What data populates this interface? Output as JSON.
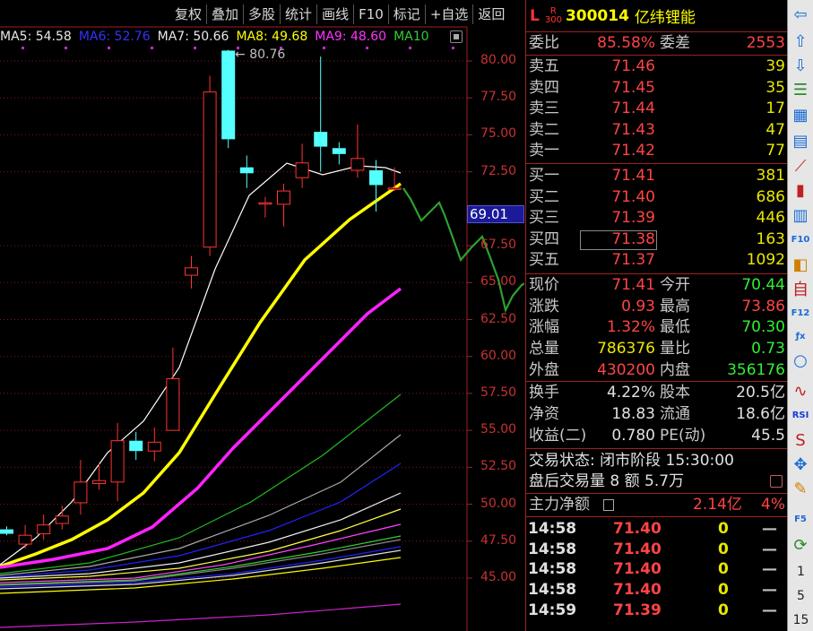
{
  "toolbar": [
    "复权",
    "叠加",
    "多股",
    "统计",
    "画线",
    "F10",
    "标记",
    "+自选",
    "返回"
  ],
  "ma_legend": [
    {
      "label": "MA5: 54.58",
      "color": "#e8e8e8"
    },
    {
      "label": "MA6: 52.76",
      "color": "#3333ff"
    },
    {
      "label": "MA7: 50.66",
      "color": "#e8e8e8"
    },
    {
      "label": "MA8: 49.68",
      "color": "#ffff00"
    },
    {
      "label": "MA9: 48.60",
      "color": "#ff33ff"
    },
    {
      "label": "MA10",
      "color": "#33cc33"
    }
  ],
  "chart_data": {
    "type": "candlestick",
    "y_ticks": [
      80.0,
      77.5,
      75.0,
      72.5,
      67.5,
      65.0,
      62.5,
      60.0,
      57.5,
      55.0,
      52.5,
      50.0,
      47.5,
      45.0
    ],
    "high_marker": "80.76",
    "current_price_tag": "69.01",
    "candles": [
      {
        "o": 48.0,
        "c": 48.3,
        "h": 48.5,
        "l": 47.9,
        "up": false
      },
      {
        "o": 47.3,
        "c": 47.9,
        "h": 48.6,
        "l": 47.0,
        "up": true
      },
      {
        "o": 48.0,
        "c": 48.6,
        "h": 49.3,
        "l": 47.6,
        "up": true
      },
      {
        "o": 48.7,
        "c": 49.2,
        "h": 49.9,
        "l": 48.3,
        "up": true
      },
      {
        "o": 50.1,
        "c": 51.5,
        "h": 53.0,
        "l": 49.3,
        "up": true
      },
      {
        "o": 51.4,
        "c": 51.6,
        "h": 52.8,
        "l": 51.0,
        "up": true
      },
      {
        "o": 51.5,
        "c": 54.3,
        "h": 55.5,
        "l": 50.2,
        "up": true
      },
      {
        "o": 54.3,
        "c": 53.6,
        "h": 54.9,
        "l": 53.0,
        "up": false
      },
      {
        "o": 53.6,
        "c": 54.2,
        "h": 55.2,
        "l": 52.9,
        "up": true
      },
      {
        "o": 55.0,
        "c": 58.5,
        "h": 60.6,
        "l": 55.0,
        "up": true
      },
      {
        "o": 65.5,
        "c": 66.0,
        "h": 66.8,
        "l": 64.6,
        "up": true
      },
      {
        "o": 67.4,
        "c": 77.9,
        "h": 79.0,
        "l": 66.8,
        "up": true
      },
      {
        "o": 80.7,
        "c": 74.7,
        "h": 80.76,
        "l": 74.1,
        "up": false
      },
      {
        "o": 72.8,
        "c": 72.4,
        "h": 73.6,
        "l": 71.4,
        "up": false
      },
      {
        "o": 70.4,
        "c": 70.4,
        "h": 70.8,
        "l": 69.4,
        "up": true
      },
      {
        "o": 70.3,
        "c": 71.2,
        "h": 71.7,
        "l": 68.8,
        "up": true
      },
      {
        "o": 72.1,
        "c": 73.1,
        "h": 74.4,
        "l": 71.4,
        "up": true
      },
      {
        "o": 75.2,
        "c": 74.2,
        "h": 80.3,
        "l": 72.5,
        "up": false
      },
      {
        "o": 74.1,
        "c": 73.7,
        "h": 74.5,
        "l": 73.0,
        "up": false
      },
      {
        "o": 72.6,
        "c": 73.4,
        "h": 75.7,
        "l": 72.1,
        "up": true
      },
      {
        "o": 72.6,
        "c": 71.6,
        "h": 73.3,
        "l": 69.8,
        "up": false
      },
      {
        "o": 71.4,
        "c": 71.4,
        "h": 72.8,
        "l": 71.2,
        "up": true
      }
    ]
  },
  "quote": {
    "market": "L",
    "r_label": "R",
    "r_sub": "300",
    "code": "300014",
    "name": "亿纬锂能",
    "weibi_label": "委比",
    "weibi": "85.58%",
    "weicha_label": "委差",
    "weicha": "2553",
    "sell": [
      {
        "label": "卖五",
        "price": "71.46",
        "vol": "39"
      },
      {
        "label": "卖四",
        "price": "71.45",
        "vol": "35"
      },
      {
        "label": "卖三",
        "price": "71.44",
        "vol": "17"
      },
      {
        "label": "卖二",
        "price": "71.43",
        "vol": "47"
      },
      {
        "label": "卖一",
        "price": "71.42",
        "vol": "77"
      }
    ],
    "buy": [
      {
        "label": "买一",
        "price": "71.41",
        "vol": "381"
      },
      {
        "label": "买二",
        "price": "71.40",
        "vol": "686"
      },
      {
        "label": "买三",
        "price": "71.39",
        "vol": "446"
      },
      {
        "label": "买四",
        "price": "71.38",
        "vol": "163"
      },
      {
        "label": "买五",
        "price": "71.37",
        "vol": "1092"
      }
    ],
    "stats": [
      {
        "l1": "现价",
        "v1": "71.41",
        "c1": "red",
        "l2": "今开",
        "v2": "70.44",
        "c2": "grn"
      },
      {
        "l1": "涨跌",
        "v1": "0.93",
        "c1": "red",
        "l2": "最高",
        "v2": "73.86",
        "c2": "red"
      },
      {
        "l1": "涨幅",
        "v1": "1.32%",
        "c1": "red",
        "l2": "最低",
        "v2": "70.30",
        "c2": "grn"
      },
      {
        "l1": "总量",
        "v1": "786376",
        "c1": "yel",
        "l2": "量比",
        "v2": "0.73",
        "c2": "grn"
      },
      {
        "l1": "外盘",
        "v1": "430200",
        "c1": "red",
        "l2": "内盘",
        "v2": "356176",
        "c2": "grn"
      }
    ],
    "fund": [
      {
        "l1": "换手",
        "v1": "4.22%",
        "l2": "股本",
        "v2": "20.5亿"
      },
      {
        "l1": "净资",
        "v1": "18.83",
        "l2": "流通",
        "v2": "18.6亿"
      },
      {
        "l1": "收益(二)",
        "v1": "0.780",
        "l2": "PE(动)",
        "v2": "45.5"
      }
    ],
    "trade_status": "交易状态: 闭市阶段 15:30:00",
    "after_hours": "盘后交易量 8 额 5.7万",
    "main_flow_label": "主力净额",
    "main_flow_value": "2.14亿",
    "main_flow_pct": "4%",
    "ticks": [
      {
        "time": "14:58",
        "price": "71.40",
        "vol": "0",
        "dir": "—"
      },
      {
        "time": "14:58",
        "price": "71.40",
        "vol": "0",
        "dir": "—"
      },
      {
        "time": "14:58",
        "price": "71.40",
        "vol": "0",
        "dir": "—"
      },
      {
        "time": "14:58",
        "price": "71.40",
        "vol": "0",
        "dir": "—"
      },
      {
        "time": "14:59",
        "price": "71.39",
        "vol": "0",
        "dir": "—"
      }
    ]
  },
  "sidebar": {
    "icons": [
      "arrow-left-icon",
      "arrow-up-icon",
      "arrow-down-icon",
      "list-icon",
      "table-icon",
      "grid-icon",
      "trend-chart-icon",
      "candle-chart-icon",
      "block-icon",
      "f10-icon",
      "compare-icon",
      "self-select-icon",
      "f12-icon",
      "formula-icon",
      "circle-icon",
      "wave-icon",
      "rsi-icon",
      "ss-icon",
      "move-icon",
      "pen-icon",
      "f5-icon",
      "refresh-icon"
    ],
    "rsi_label": "RSI",
    "f5_label": "F5",
    "f12_label": "F12",
    "f10_label": "F10",
    "periods": [
      "1",
      "5",
      "15"
    ]
  }
}
